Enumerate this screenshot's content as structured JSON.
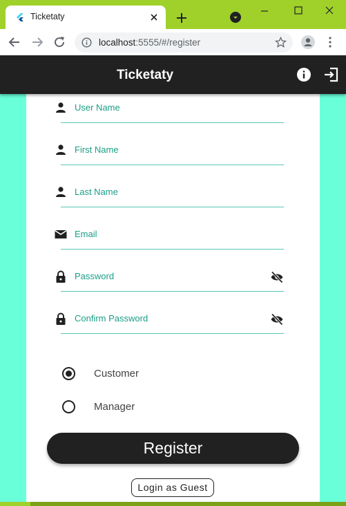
{
  "browser": {
    "tab_title": "Ticketaty",
    "url_host": "localhost",
    "url_rest": ":5555/#/register"
  },
  "app": {
    "title": "Ticketaty"
  },
  "form": {
    "fields": [
      {
        "label": "User Name",
        "icon": "person-icon"
      },
      {
        "label": "First Name",
        "icon": "person-icon"
      },
      {
        "label": "Last Name",
        "icon": "person-icon"
      },
      {
        "label": "Email",
        "icon": "email-icon"
      },
      {
        "label": "Password",
        "icon": "lock-icon"
      },
      {
        "label": "Confirm Password",
        "icon": "lock-icon"
      }
    ],
    "roles": [
      {
        "label": "Customer",
        "selected": true
      },
      {
        "label": "Manager",
        "selected": false
      }
    ],
    "register_label": "Register",
    "guest_label": "Login as Guest"
  },
  "colors": {
    "accent": "#1a9e87",
    "appbar": "#212121",
    "background": "#69ffd9",
    "chrome": "#9fd12a"
  }
}
